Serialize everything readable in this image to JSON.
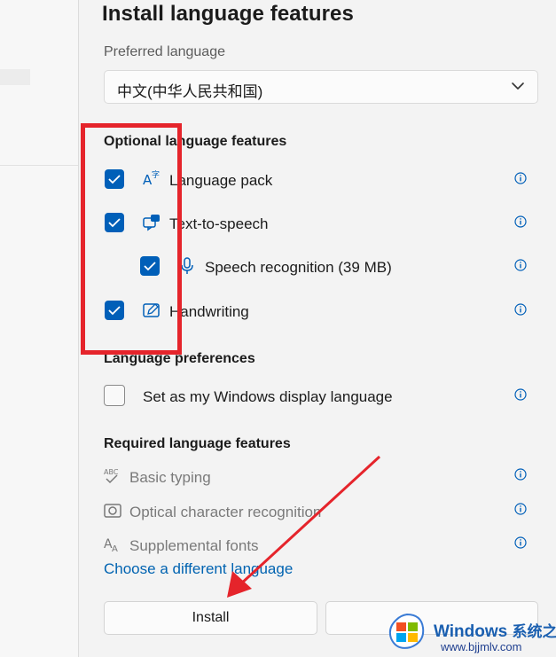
{
  "dialog": {
    "title": "Install language features",
    "preferred_language_label": "Preferred language",
    "preferred_language_value": "中文(中华人民共和国)"
  },
  "optional": {
    "heading": "Optional language features",
    "items": [
      {
        "label": "Language pack",
        "checked": true,
        "icon": "language-pack-icon"
      },
      {
        "label": "Text-to-speech",
        "checked": true,
        "icon": "text-to-speech-icon"
      },
      {
        "label": "Speech recognition (39 MB)",
        "checked": true,
        "icon": "microphone-icon"
      },
      {
        "label": "Handwriting",
        "checked": true,
        "icon": "handwriting-icon"
      }
    ]
  },
  "preferences": {
    "heading": "Language preferences",
    "display_language_label": "Set as my Windows display language",
    "display_language_checked": false
  },
  "required": {
    "heading": "Required language features",
    "items": [
      {
        "label": "Basic typing",
        "icon": "basic-typing-icon"
      },
      {
        "label": "Optical character recognition",
        "icon": "ocr-icon"
      },
      {
        "label": "Supplemental fonts",
        "icon": "fonts-icon"
      }
    ]
  },
  "link": "Choose a different language",
  "buttons": {
    "install": "Install",
    "cancel": ""
  },
  "watermark": {
    "brand": "Windows",
    "brand_cn": "系统之家",
    "url": "www.bjjmlv.com"
  },
  "colors": {
    "accent": "#005fb8",
    "annotation": "#e5242b",
    "link": "#0063b1"
  }
}
